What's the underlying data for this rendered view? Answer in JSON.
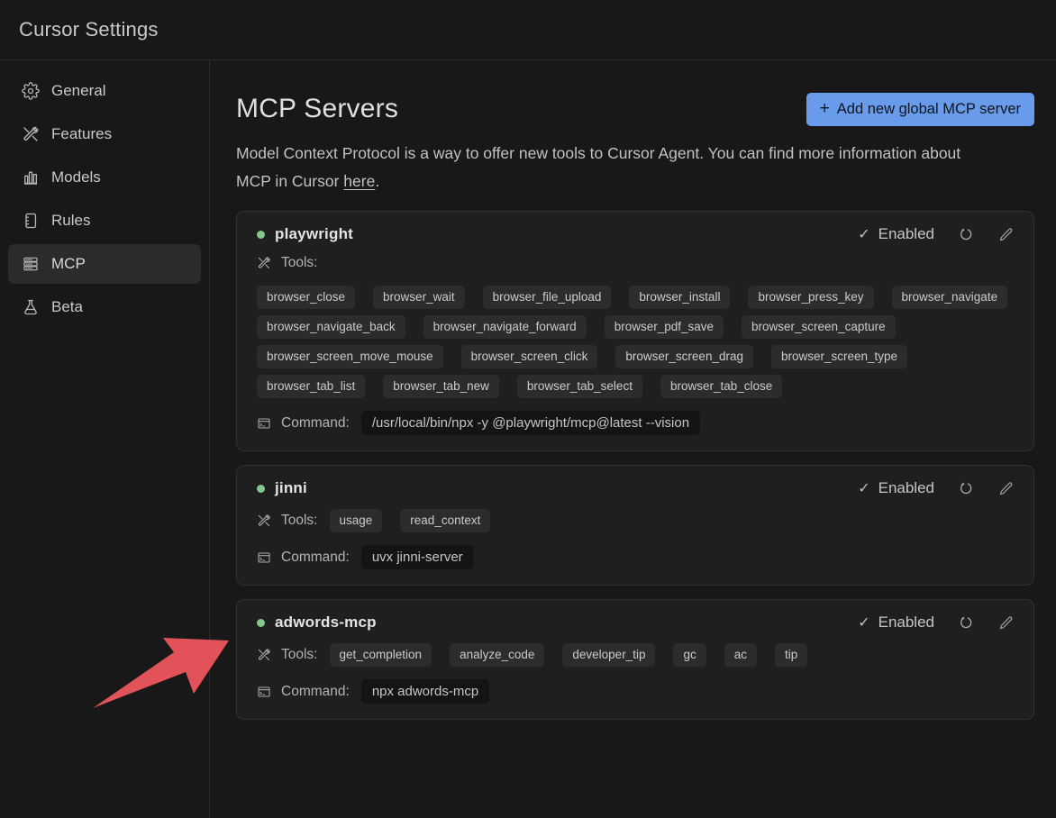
{
  "window": {
    "title": "Cursor Settings"
  },
  "sidebar": {
    "items": [
      {
        "label": "General",
        "icon": "gear-icon",
        "active": false
      },
      {
        "label": "Features",
        "icon": "tools-icon",
        "active": false
      },
      {
        "label": "Models",
        "icon": "bar-chart-icon",
        "active": false
      },
      {
        "label": "Rules",
        "icon": "notebook-icon",
        "active": false
      },
      {
        "label": "MCP",
        "icon": "server-stack-icon",
        "active": true
      },
      {
        "label": "Beta",
        "icon": "flask-icon",
        "active": false
      }
    ]
  },
  "main": {
    "title": "MCP Servers",
    "add_button": {
      "plus": "+",
      "label": "Add new global MCP server"
    },
    "description": {
      "before": "Model Context Protocol is a way to offer new tools to Cursor Agent. You can find more information about MCP in Cursor ",
      "link": "here",
      "after": "."
    },
    "tools_label": "Tools:",
    "command_label": "Command:",
    "servers": [
      {
        "name": "playwright",
        "status": "Enabled",
        "tools": [
          "browser_close",
          "browser_wait",
          "browser_file_upload",
          "browser_install",
          "browser_press_key",
          "browser_navigate",
          "browser_navigate_back",
          "browser_navigate_forward",
          "browser_pdf_save",
          "browser_screen_capture",
          "browser_screen_move_mouse",
          "browser_screen_click",
          "browser_screen_drag",
          "browser_screen_type",
          "browser_tab_list",
          "browser_tab_new",
          "browser_tab_select",
          "browser_tab_close"
        ],
        "command": "/usr/local/bin/npx -y @playwright/mcp@latest --vision"
      },
      {
        "name": "jinni",
        "status": "Enabled",
        "tools": [
          "usage",
          "read_context"
        ],
        "command": "uvx jinni-server"
      },
      {
        "name": "adwords-mcp",
        "status": "Enabled",
        "tools": [
          "get_completion",
          "analyze_code",
          "developer_tip",
          "gc",
          "ac",
          "tip"
        ],
        "command": "npx adwords-mcp"
      }
    ]
  },
  "icons": {
    "check": "✓"
  },
  "colors": {
    "accent_blue": "#689bea",
    "arrow_red": "#e25359",
    "status_green_dot": "#85c88f",
    "background": "#181818",
    "card_background": "#1f1f1f"
  }
}
